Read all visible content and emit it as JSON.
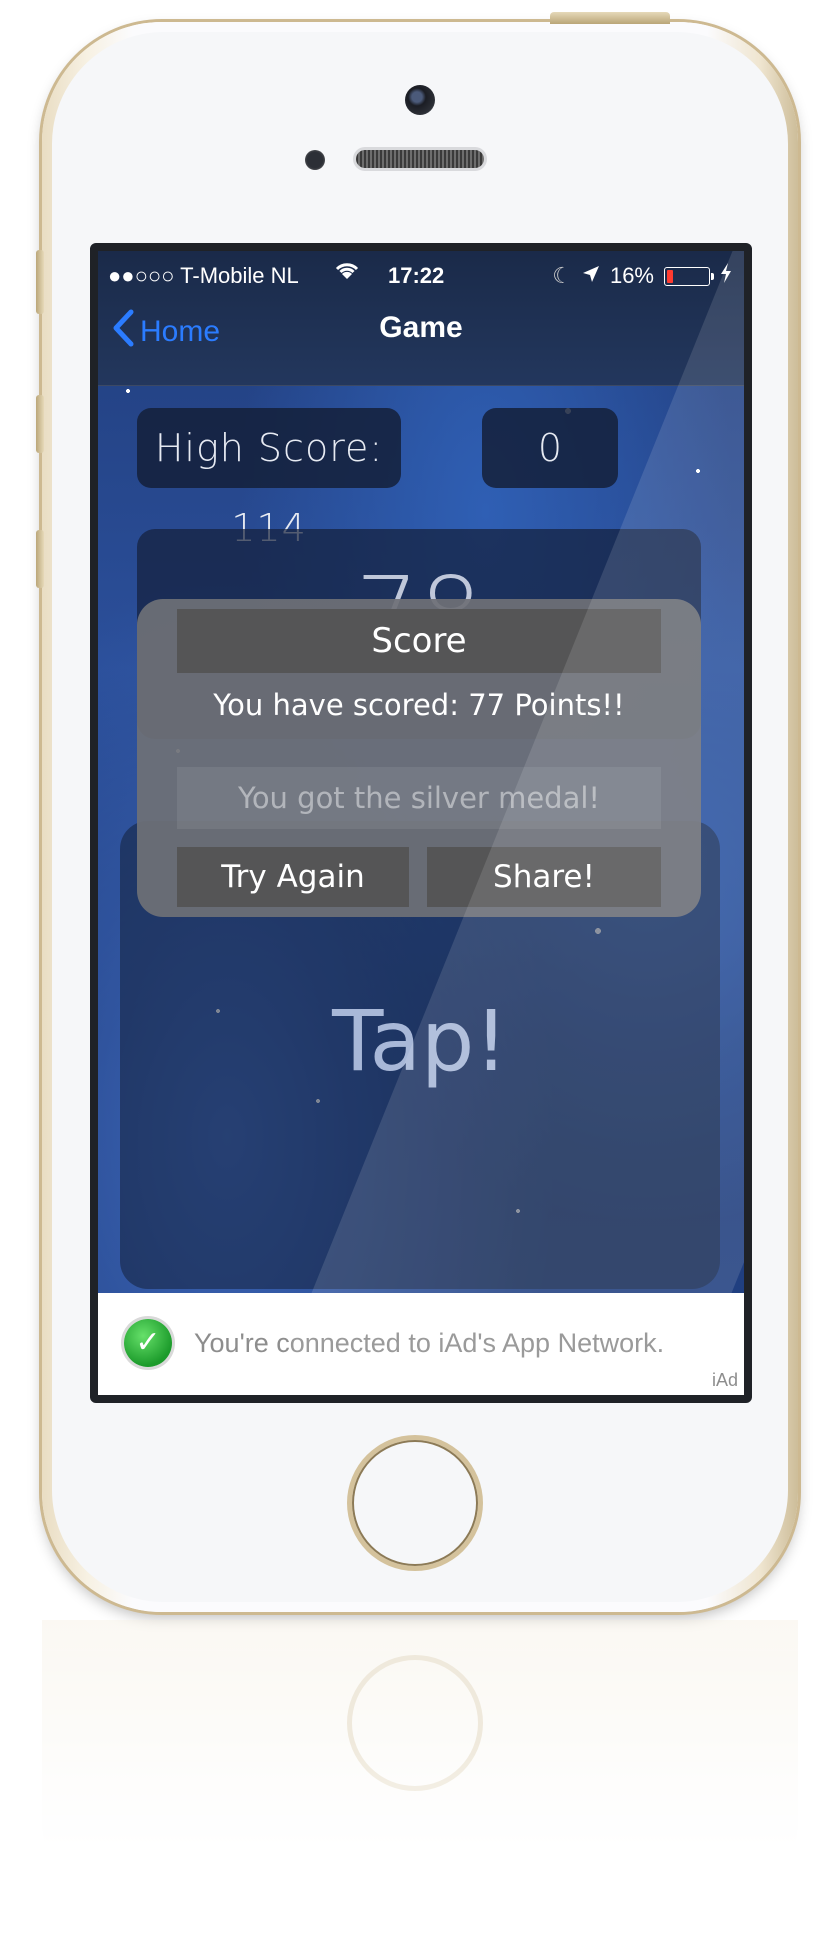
{
  "status_bar": {
    "carrier": "●●○○○ T-Mobile NL",
    "time": "17:22",
    "battery": "16%",
    "battery_level": 0.16
  },
  "nav": {
    "back_label": "Home",
    "title": "Game"
  },
  "game": {
    "high_score": "High Score: 114",
    "current_score": "0",
    "countdown": "78",
    "tap_label": "Tap!"
  },
  "alert": {
    "title": "Score",
    "message": "You have scored: 77 Points!!",
    "medal": "You got the silver medal!",
    "try_again": "Try Again",
    "share": "Share!"
  },
  "ad": {
    "message": "You're connected to iAd's App Network.",
    "badge": "iAd"
  },
  "colors": {
    "link_blue": "#2b7cff",
    "battery_low": "#ff3b30",
    "alert_gray": "#555556"
  }
}
